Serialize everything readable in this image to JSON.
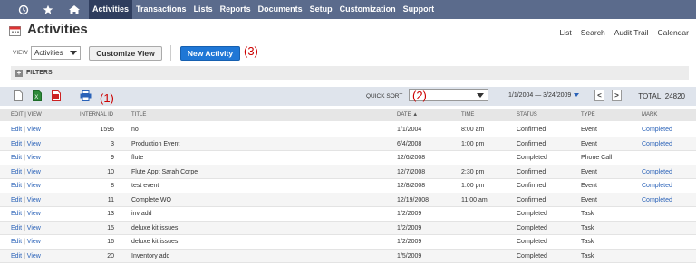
{
  "nav": {
    "icons": [
      "recent-icon",
      "star-icon",
      "home-icon"
    ],
    "items": [
      {
        "label": "Activities",
        "active": true
      },
      {
        "label": "Transactions"
      },
      {
        "label": "Lists"
      },
      {
        "label": "Reports"
      },
      {
        "label": "Documents"
      },
      {
        "label": "Setup"
      },
      {
        "label": "Customization"
      },
      {
        "label": "Support"
      }
    ]
  },
  "header": {
    "title": "Activities",
    "links": [
      "List",
      "Search",
      "Audit Trail",
      "Calendar"
    ]
  },
  "view": {
    "label": "VIEW",
    "selected": "Activities",
    "customize_label": "Customize View",
    "new_label": "New Activity"
  },
  "annotations": {
    "one": "(1)",
    "two": "(2)",
    "three": "(3)"
  },
  "filters": {
    "label": "FILTERS"
  },
  "toolbar": {
    "quick_sort_label": "QUICK SORT",
    "quick_sort_value": "",
    "date_range": "1/1/2004 — 3/24/2009",
    "prev": "<",
    "next": ">",
    "total": "TOTAL: 24820"
  },
  "table": {
    "columns": {
      "edit": "EDIT | VIEW",
      "id": "INTERNAL ID",
      "title": "TITLE",
      "date": "DATE",
      "time": "TIME",
      "status": "STATUS",
      "type": "TYPE",
      "mark": "MARK"
    },
    "edit_label": "Edit",
    "sep": " | ",
    "view_label": "View",
    "rows": [
      {
        "id": "1596",
        "title": "no",
        "date": "1/1/2004",
        "time": "8:00 am",
        "status": "Confirmed",
        "type": "Event",
        "mark": "Completed"
      },
      {
        "id": "3",
        "title": "Production Event",
        "date": "6/4/2008",
        "time": "1:00 pm",
        "status": "Confirmed",
        "type": "Event",
        "mark": "Completed"
      },
      {
        "id": "9",
        "title": "flute",
        "date": "12/6/2008",
        "time": "",
        "status": "Completed",
        "type": "Phone Call",
        "mark": ""
      },
      {
        "id": "10",
        "title": "Flute Appt Sarah Corpe",
        "date": "12/7/2008",
        "time": "2:30 pm",
        "status": "Confirmed",
        "type": "Event",
        "mark": "Completed"
      },
      {
        "id": "8",
        "title": "test event",
        "date": "12/8/2008",
        "time": "1:00 pm",
        "status": "Confirmed",
        "type": "Event",
        "mark": "Completed"
      },
      {
        "id": "11",
        "title": "Complete WO",
        "date": "12/19/2008",
        "time": "11:00 am",
        "status": "Confirmed",
        "type": "Event",
        "mark": "Completed"
      },
      {
        "id": "13",
        "title": "inv add",
        "date": "1/2/2009",
        "time": "",
        "status": "Completed",
        "type": "Task",
        "mark": ""
      },
      {
        "id": "15",
        "title": "deluxe kit issues",
        "date": "1/2/2009",
        "time": "",
        "status": "Completed",
        "type": "Task",
        "mark": ""
      },
      {
        "id": "16",
        "title": "deluxe kit issues",
        "date": "1/2/2009",
        "time": "",
        "status": "Completed",
        "type": "Task",
        "mark": ""
      },
      {
        "id": "20",
        "title": "Inventory add",
        "date": "1/5/2009",
        "time": "",
        "status": "Completed",
        "type": "Task",
        "mark": ""
      }
    ]
  },
  "colors": {
    "nav_bg": "#5b6b8c",
    "nav_active": "#2f3d5e",
    "link": "#2a62b8",
    "primary_button": "#1f77d6",
    "annotation": "#cc0000"
  }
}
